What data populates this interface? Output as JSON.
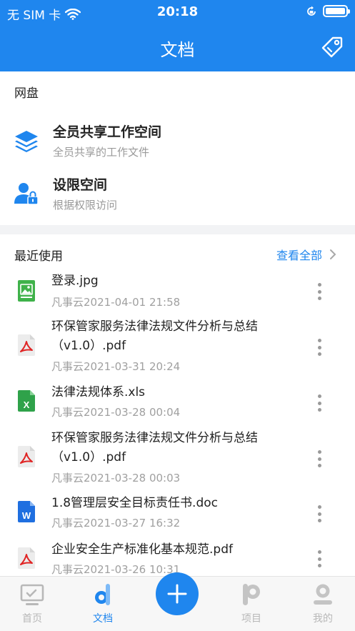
{
  "status_bar": {
    "carrier": "无 SIM 卡",
    "time": "20:18"
  },
  "header": {
    "title": "文档",
    "background": "#1f86ee"
  },
  "netdisk": {
    "section_title": "网盘",
    "items": [
      {
        "title": "全员共享工作空间",
        "subtitle": "全员共享的工作文件",
        "icon": "layers-icon"
      },
      {
        "title": "设限空间",
        "subtitle": "根据权限访问",
        "icon": "user-lock-icon"
      }
    ]
  },
  "recent": {
    "section_title": "最近使用",
    "see_all": "查看全部",
    "files": [
      {
        "name": "登录.jpg",
        "meta": "凡事云2021-04-01 21:58",
        "type": "image"
      },
      {
        "name": "环保管家服务法律法规文件分析与总结（v1.0）.pdf",
        "meta": "凡事云2021-03-31 20:24",
        "type": "pdf"
      },
      {
        "name": "法律法规体系.xls",
        "meta": "凡事云2021-03-28 00:04",
        "type": "excel"
      },
      {
        "name": "环保管家服务法律法规文件分析与总结（v1.0）.pdf",
        "meta": "凡事云2021-03-28 00:03",
        "type": "pdf"
      },
      {
        "name": "1.8管理层安全目标责任书.doc",
        "meta": "凡事云2021-03-27 16:32",
        "type": "word"
      },
      {
        "name": "企业安全生产标准化基本规范.pdf",
        "meta": "凡事云2021-03-26 10:31",
        "type": "pdf"
      }
    ]
  },
  "tabbar": {
    "tabs": [
      {
        "label": "首页",
        "icon": "monitor-icon"
      },
      {
        "label": "文档",
        "icon": "document-d-icon",
        "active": true
      },
      {
        "label": "",
        "icon": "plus-icon"
      },
      {
        "label": "项目",
        "icon": "project-p-icon"
      },
      {
        "label": "我的",
        "icon": "profile-icon"
      }
    ]
  }
}
